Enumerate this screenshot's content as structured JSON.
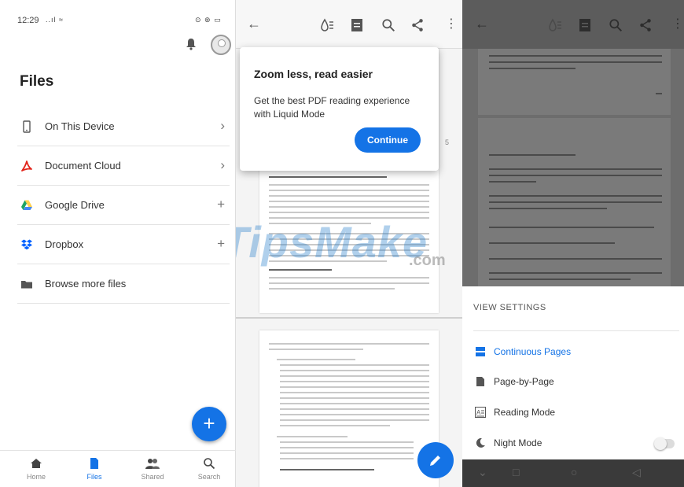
{
  "files_screen": {
    "status_time": "12:29",
    "status_signal": "..ıl ≈",
    "status_right": "⊙ ⊛ ▭",
    "title": "Files",
    "locations": [
      {
        "label": "On This Device",
        "action": "›"
      },
      {
        "label": "Document Cloud",
        "action": "›"
      },
      {
        "label": "Google Drive",
        "action": "+"
      },
      {
        "label": "Dropbox",
        "action": "+"
      },
      {
        "label": "Browse more files",
        "action": ""
      }
    ],
    "fab_label": "+",
    "bottom_nav": [
      {
        "label": "Home"
      },
      {
        "label": "Files"
      },
      {
        "label": "Shared"
      },
      {
        "label": "Search"
      }
    ]
  },
  "pdf_screen": {
    "popup_title": "Zoom less, read easier",
    "popup_text": "Get the best PDF reading experience with Liquid Mode",
    "continue_label": "Continue",
    "page_number": "5"
  },
  "settings_screen": {
    "heading": "VIEW SETTINGS",
    "options": [
      {
        "label": "Continuous Pages"
      },
      {
        "label": "Page-by-Page"
      },
      {
        "label": "Reading Mode"
      },
      {
        "label": "Night Mode"
      }
    ]
  },
  "watermark": "TipsMake",
  "watermark_suffix": ".com",
  "colors": {
    "accent": "#1473e6",
    "acrobat_red": "#e2231a",
    "drive_green": "#1fa463",
    "drive_yellow": "#ffd04b",
    "drive_blue": "#4688f4",
    "dropbox_blue": "#0061ff"
  }
}
